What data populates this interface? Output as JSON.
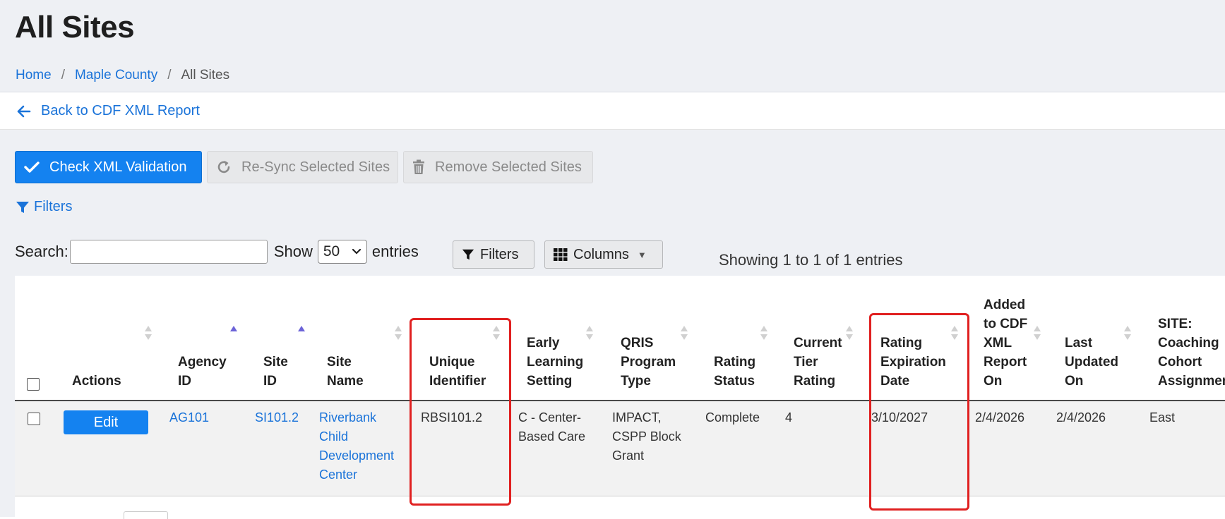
{
  "header": {
    "title": "All Sites",
    "breadcrumb": [
      {
        "label": "Home"
      },
      {
        "label": "Maple County"
      },
      {
        "label": "All Sites"
      }
    ],
    "breadcrumb_separator": "/"
  },
  "backbar": {
    "label": "Back to CDF XML Report"
  },
  "toolbar": {
    "check_xml": "Check XML Validation",
    "resync": "Re-Sync Selected Sites",
    "remove": "Remove Selected Sites",
    "filters_link": "Filters"
  },
  "table_controls": {
    "search_label": "Search:",
    "search_value": "",
    "show_label": "Show",
    "entries_value": "50",
    "entries_label": "entries",
    "filters_button": "Filters",
    "columns_button": "Columns",
    "info": "Showing 1 to 1 of 1 entries"
  },
  "table": {
    "headers": [
      "Actions",
      "Agency ID",
      "Site ID",
      "Site Name",
      "Unique Identifier",
      "Early Learning Setting",
      "QRIS Program Type",
      "Rating Status",
      "Current Tier Rating",
      "Rating Expiration Date",
      "Added to CDF XML Report On",
      "Last Updated On",
      "SITE: Coaching Cohort Assignment"
    ],
    "header_lines": [
      [
        "Actions"
      ],
      [
        "Agency",
        "ID"
      ],
      [
        "Site",
        "ID"
      ],
      [
        "Site",
        "Name"
      ],
      [
        "Unique",
        "Identifier"
      ],
      [
        "Early",
        "Learning",
        "Setting"
      ],
      [
        "QRIS",
        "Program",
        "Type"
      ],
      [
        "Rating",
        "Status"
      ],
      [
        "Current",
        "Tier",
        "Rating"
      ],
      [
        "Rating",
        "Expiration",
        "Date"
      ],
      [
        "Added",
        "to CDF",
        "XML",
        "Report",
        "On"
      ],
      [
        "Last",
        "Updated",
        "On"
      ],
      [
        "SITE:",
        "Coaching",
        "Cohort",
        "Assignment"
      ]
    ],
    "rows": [
      {
        "action": "Edit",
        "agency_id": "AG101",
        "site_id": "SI101.2",
        "site_name": "Riverbank Child Development Center",
        "site_name_lines": [
          "Riverbank",
          "Child",
          "Development",
          "Center"
        ],
        "unique_identifier": "RBSI101.2",
        "early_learning_setting": "C - Center-Based Care",
        "els_lines": [
          "C - Center-",
          "Based Care"
        ],
        "qris_program_type": "IMPACT, CSPP Block Grant",
        "qris_lines": [
          "IMPACT,",
          "CSPP Block",
          "Grant"
        ],
        "rating_status": "Complete",
        "current_tier_rating": "4",
        "rating_expiration_date": "3/10/2027",
        "added_on": "2/4/2026",
        "last_updated_on": "2/4/2026",
        "coaching_cohort": "East"
      }
    ]
  },
  "colors": {
    "primary": "#1482f0",
    "link": "#1a73d9",
    "header_bg": "#eef0f4",
    "highlight": "#e02020",
    "sort_active": "#6c63d8"
  }
}
